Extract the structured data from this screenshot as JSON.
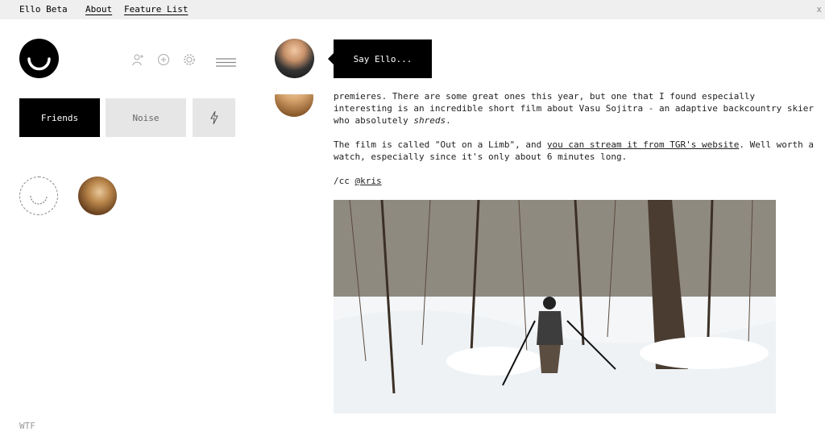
{
  "topbar": {
    "brand": "Ello Beta",
    "about": "About",
    "feature_list": "Feature List",
    "close": "x"
  },
  "icons": {
    "invite": "add-person-icon",
    "omnibar": "plus-circle-icon",
    "settings": "gear-icon",
    "menu": "hamburger-icon"
  },
  "tabs": {
    "friends": "Friends",
    "noise": "Noise",
    "notifications": "bolt-icon"
  },
  "sidebar_footer": {
    "wtf": "WTF"
  },
  "composer": {
    "prompt": "Say Ello..."
  },
  "post": {
    "line1": "premieres. There are some great ones this year, but one that I found especially",
    "line2": "interesting is an incredible short film about Vasu Sojitra - an adaptive backcountry skier",
    "line3a": "who absolutely ",
    "line3b": "shreds",
    "line3c": ".",
    "p2a": "The film is called \"Out on a Limb\", and ",
    "p2link": "you can stream it from TGR's website",
    "p2b": ". Well worth a",
    "p2c": "watch, especially since it's only about 6 minutes long.",
    "cc": "/cc ",
    "mention": "@kris"
  },
  "colors": {
    "topbar_bg": "#efefef",
    "active_tab": "#000000",
    "inactive_tab": "#e6e6e6"
  }
}
